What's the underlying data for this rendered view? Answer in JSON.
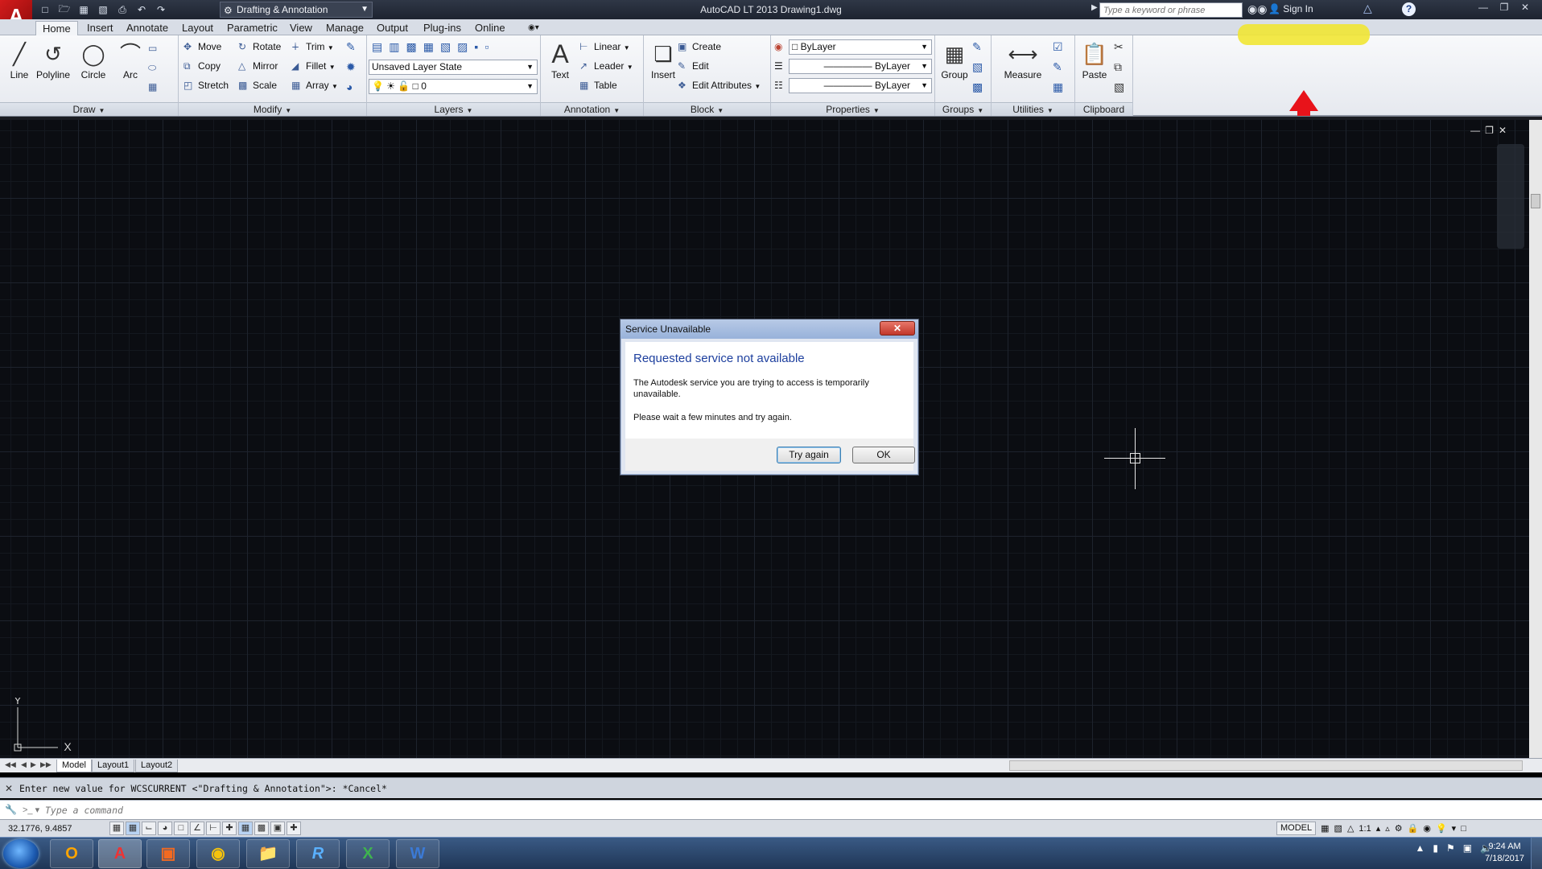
{
  "window": {
    "app_logo": "A",
    "workspace": "Drafting & Annotation",
    "title": "AutoCAD LT 2013    Drawing1.dwg",
    "search_placeholder": "Type a keyword or phrase",
    "sign_in": "Sign In"
  },
  "qat_icons": [
    "new-icon",
    "open-icon",
    "save-icon",
    "save-as-icon",
    "print-icon",
    "undo-icon",
    "redo-icon"
  ],
  "tabs": [
    "Home",
    "Insert",
    "Annotate",
    "Layout",
    "Parametric",
    "View",
    "Manage",
    "Output",
    "Plug-ins",
    "Online"
  ],
  "panels": {
    "draw": {
      "title": "Draw",
      "line": "Line",
      "polyline": "Polyline",
      "circle": "Circle",
      "arc": "Arc"
    },
    "modify": {
      "title": "Modify",
      "move": "Move",
      "rotate": "Rotate",
      "trim": "Trim",
      "copy": "Copy",
      "mirror": "Mirror",
      "fillet": "Fillet",
      "stretch": "Stretch",
      "scale": "Scale",
      "array": "Array"
    },
    "layers": {
      "title": "Layers",
      "layer_state": "Unsaved Layer State",
      "current_layer": "0"
    },
    "annotation": {
      "title": "Annotation",
      "text": "Text",
      "linear": "Linear",
      "leader": "Leader",
      "table": "Table"
    },
    "block": {
      "title": "Block",
      "insert": "Insert",
      "create": "Create",
      "edit": "Edit",
      "edit_attributes": "Edit Attributes"
    },
    "properties": {
      "title": "Properties",
      "color": "ByLayer",
      "linetype": "ByLayer",
      "lineweight": "ByLayer"
    },
    "groups": {
      "title": "Groups",
      "group": "Group"
    },
    "utilities": {
      "title": "Utilities",
      "measure": "Measure"
    },
    "clipboard": {
      "title": "Clipboard",
      "paste": "Paste"
    }
  },
  "dialog": {
    "title": "Service Unavailable",
    "heading": "Requested service not available",
    "message": "The Autodesk service you are trying to access is temporarily unavailable.",
    "message2": "Please wait a few minutes and try again.",
    "try_again": "Try again",
    "ok": "OK"
  },
  "ucs": {
    "y": "Y",
    "x": "X"
  },
  "layout_tabs": [
    "Model",
    "Layout1",
    "Layout2"
  ],
  "command": {
    "history": "Enter new value for WCSCURRENT <\"Drafting & Annotation\">: *Cancel*",
    "placeholder": "Type a command"
  },
  "status": {
    "coords": "32.1776, 9.4857",
    "model": "MODEL",
    "scale": "1:1"
  },
  "clock": {
    "time": "9:24 AM",
    "date": "7/18/2017"
  },
  "colors": {
    "annotation_arrow": "#e8131a",
    "highlight": "#f1e534",
    "dialog_heading": "#1d3f9e"
  }
}
